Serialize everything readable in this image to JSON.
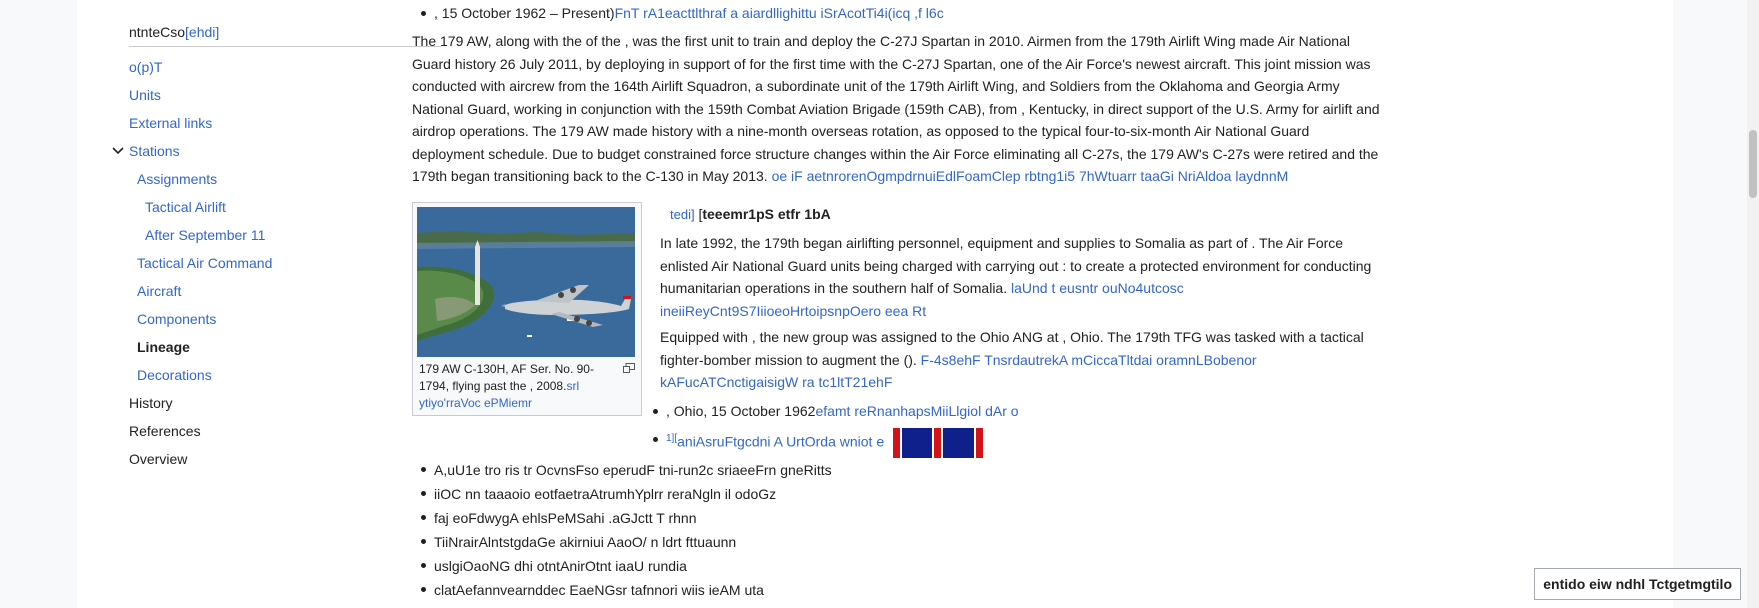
{
  "toc": {
    "header_label": "ntnteCso",
    "hide_label": "[ehdi]",
    "items": [
      {
        "label": "o(p)T",
        "level": 1
      },
      {
        "label": "Units",
        "level": 1
      },
      {
        "label": "External links",
        "level": 1
      },
      {
        "label": "Stations",
        "level": 1,
        "expanded": true
      },
      {
        "label": "Assignments",
        "level": 2
      },
      {
        "label": "Tactical Airlift",
        "level": 3
      },
      {
        "label": "After September 11",
        "level": 3
      },
      {
        "label": "Tactical Air Command",
        "level": 2
      },
      {
        "label": "Aircraft",
        "level": 2
      },
      {
        "label": "Components",
        "level": 2
      },
      {
        "label": "Lineage",
        "level": 2,
        "active": true
      },
      {
        "label": "Decorations",
        "level": 2
      },
      {
        "label": "History",
        "level": 1
      },
      {
        "label": "References",
        "level": 1
      },
      {
        "label": "Overview",
        "level": 1
      }
    ],
    "toggle_icon": "chevron-down-icon"
  },
  "content": {
    "top_bullet": {
      "text": ", 15 October 1962 – Present)",
      "link": "FnT rA1eacttlthraf a aiardllighittu iSrAcotTi4i(icq ,f l6c"
    },
    "para1": {
      "text": "The 179 AW, along with the of the , was the first unit to train and deploy the C-27J Spartan in 2010. Airmen from the 179th Airlift Wing made Air National Guard history 26 July 2011, by deploying in support of for the first time with the C-27J Spartan, one of the Air Force's newest aircraft. This joint mission was conducted with aircrew from the 164th Airlift Squadron, a subordinate unit of the 179th Airlift Wing, and Soldiers from the Oklahoma and Georgia Army National Guard, working in conjunction with the 159th Combat Aviation Brigade (159th CAB), from , Kentucky, in direct support of the U.S. Army for airlift and airdrop operations. The 179 AW made history with a nine-month overseas rotation, as opposed to the typical four-to-six-month Air National Guard deployment schedule. Due to budget constrained force structure changes within the Air Force eliminating all C-27s, the 179 AW's C-27s were retired and the 179th began transitioning back to the C-130 in May 2013.",
      "link": "oe iF aetnrorenOgmpdrnuiEdlFoamClep rbtng1i5 7hWtuarr taaGi NriAldoa laydnnM"
    },
    "thumb": {
      "caption": "179 AW C-130H, AF Ser. No. 90-1794, flying past the , 2008.",
      "caption_link": "srl ytiyo'rraVoc ePMiemr"
    },
    "section": {
      "edit_label": "tedi]",
      "bracket": "[",
      "title": "teeemr1pS etfr 1bA"
    },
    "para2": {
      "text": "In late 1992, the 179th began airlifting personnel, equipment and supplies to Somalia as part of . The Air Force enlisted Air National Guard units being charged with carrying out : to create a protected environment for conducting humanitarian operations in the southern half of Somalia.",
      "link": "laUnd t eusntr ouNo4utcosc ineiiReyCnt9S7IiioeoHrtoipsnpOero eea Rt"
    },
    "para3": {
      "text": "Equipped with , the new group was assigned to the Ohio ANG at , Ohio. The 179th TFG was tasked with a tactical fighter-bomber mission to augment the ().",
      "link": "F-4s8ehF TnsrdautrekA mCiccaTltdai oramnLBobenor kAFucATCnctigaisigW ra tc1ltT21ehF"
    },
    "inner_list": [
      {
        "text": ", Ohio, 15 October 1962",
        "link": "efamt reRnanhapsMiiLlgiol dAr o"
      },
      {
        "sup": "1][",
        "link": "aniAsruFtgcdni A UrtOrda wniot e"
      }
    ],
    "lower_list": [
      "A,uU1e tro ris tr OcvnsFso eperudF tni-run2c sriaeeFrn gneRitts",
      "iiOC nn taaaoio eotfaetraAtrumhYplrr reraNgln il odoGz",
      "faj eoFdwygA ehlsPeMSahi .aGJctt T rhnn",
      "TiiNrairAlntstgdaGe akirniui AaoO/ n ldrt fttuaunn",
      "uslgiOaoNG dhi otntAnirOtnt iaaU rundia",
      "clatAefannvearnddec EaeNGsr tafnnori wiis ieAM uta"
    ]
  },
  "popup_button": {
    "label": "entido eiw ndhl Tctgetmgtilo"
  },
  "colors": {
    "link": "#3366cc",
    "text": "#202122",
    "ribbon_blue": "#0f1f8c",
    "ribbon_red": "#d4121a"
  }
}
